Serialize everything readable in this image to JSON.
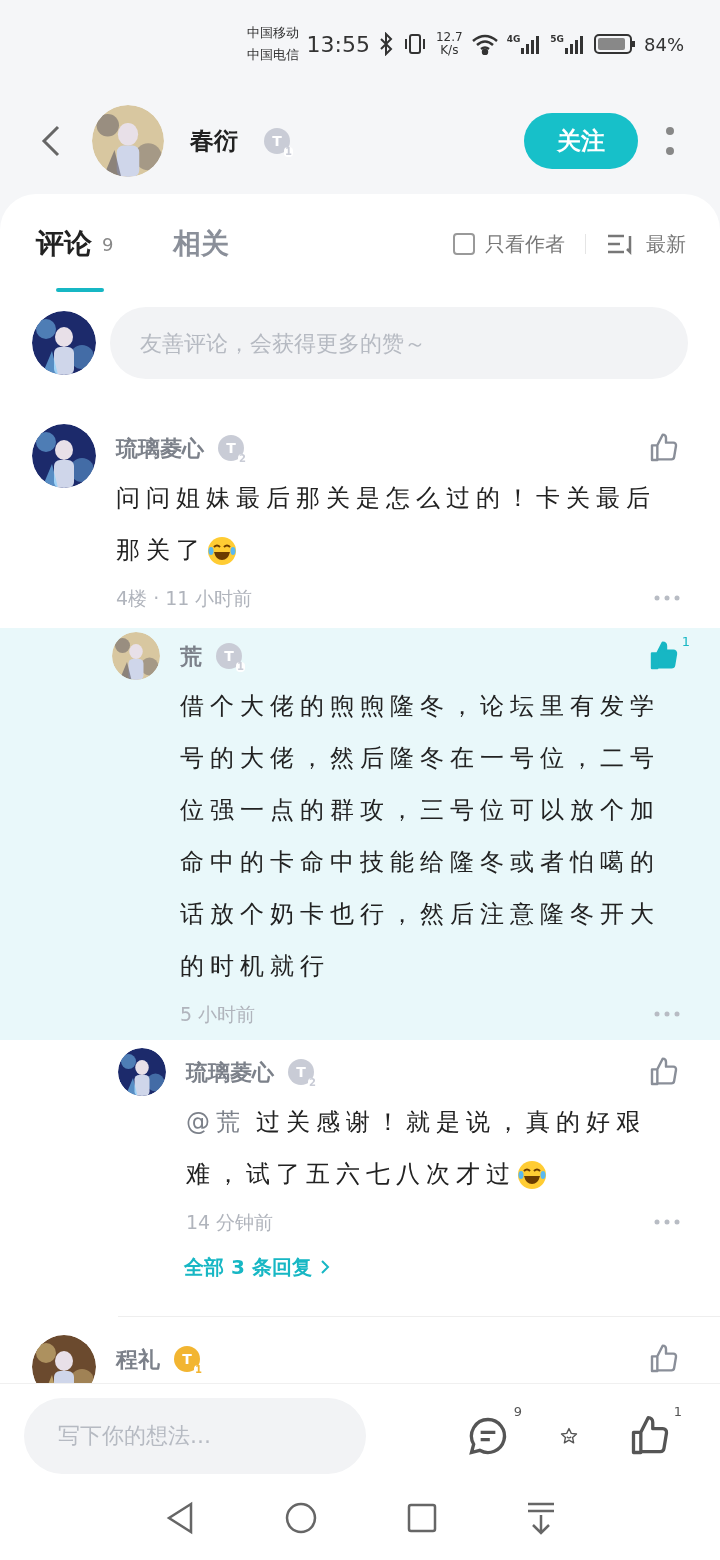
{
  "status_bar": {
    "carriers": [
      "中国移动",
      "中国电信"
    ],
    "time": "13:55",
    "speed": [
      "12.7",
      "K/s"
    ],
    "networks": [
      "4G",
      "5G"
    ],
    "battery": "84%"
  },
  "header": {
    "name": "春衍",
    "badge": {
      "letter": "T",
      "level": "1",
      "color": "#c9ccd6"
    },
    "follow": "关注"
  },
  "tabs": [
    {
      "label": "评论",
      "count": "9",
      "selected": true
    },
    {
      "label": "相关",
      "selected": false
    }
  ],
  "filters": {
    "author_only": {
      "label": "只看作者",
      "checked": false
    },
    "sort": "最新"
  },
  "composer": {
    "placeholder": "友善评论，会获得更多的赞～"
  },
  "comments": [
    {
      "kind": "comment",
      "name": "琉璃菱心",
      "badge": {
        "letter": "T",
        "level": "2",
        "color": "#c9ccd6"
      },
      "text": "问问姐妹最后那关是怎么过的！卡关最后那关了",
      "emoji": true,
      "meta": "4楼 · 11 小时前",
      "liked": false
    },
    {
      "kind": "reply",
      "name": "荒",
      "badge": {
        "letter": "T",
        "level": "1",
        "color": "#c9ccd6"
      },
      "text": "借个大佬的煦煦隆冬，论坛里有发学号的大佬，然后隆冬在一号位，二号位强一点的群攻，三号位可以放个加命中的卡命中技能给隆冬或者怕噶的话放个奶卡也行，然后注意隆冬开大的时机就行",
      "emoji": false,
      "meta": "5 小时前",
      "liked": true,
      "like_count": "1",
      "highlighted": true
    },
    {
      "kind": "reply",
      "name": "琉璃菱心",
      "badge": {
        "letter": "T",
        "level": "2",
        "color": "#c9ccd6"
      },
      "mention": "@荒",
      "text": "过关感谢！就是说，真的好艰难，试了五六七八次才过",
      "emoji": true,
      "meta": "14 分钟前",
      "liked": false
    },
    {
      "kind": "more",
      "text": "全部 3 条回复"
    },
    {
      "kind": "cut",
      "name": "程礼",
      "badge": {
        "letter": "T",
        "level": "1",
        "color": "#f2b531"
      },
      "liked": false
    }
  ],
  "bottom_bar": {
    "placeholder": "写下你的想法...",
    "comment_count": "9",
    "like_count": "1"
  }
}
